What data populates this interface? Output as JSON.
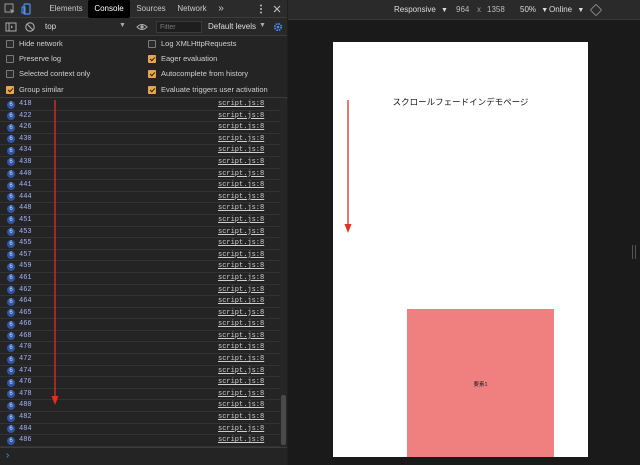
{
  "devtools": {
    "tabs": [
      {
        "label": "Elements"
      },
      {
        "label": "Console"
      },
      {
        "label": "Sources"
      },
      {
        "label": "Network"
      }
    ],
    "more_tabs": "»",
    "context": "top",
    "filter_placeholder": "Filter",
    "levels": "Default levels",
    "settings": {
      "left": [
        {
          "label": "Hide network",
          "checked": false
        },
        {
          "label": "Preserve log",
          "checked": false
        },
        {
          "label": "Selected context only",
          "checked": false
        },
        {
          "label": "Group similar",
          "checked": true
        }
      ],
      "right": [
        {
          "label": "Log XMLHttpRequests",
          "checked": false
        },
        {
          "label": "Eager evaluation",
          "checked": true
        },
        {
          "label": "Autocomplete from history",
          "checked": true
        },
        {
          "label": "Evaluate triggers user activation",
          "checked": true
        }
      ]
    },
    "log_rows": [
      {
        "count": "6",
        "value": "418",
        "source": "script.js:8"
      },
      {
        "count": "6",
        "value": "422",
        "source": "script.js:8"
      },
      {
        "count": "6",
        "value": "426",
        "source": "script.js:8"
      },
      {
        "count": "6",
        "value": "430",
        "source": "script.js:8"
      },
      {
        "count": "6",
        "value": "434",
        "source": "script.js:8"
      },
      {
        "count": "6",
        "value": "438",
        "source": "script.js:8"
      },
      {
        "count": "6",
        "value": "440",
        "source": "script.js:8"
      },
      {
        "count": "6",
        "value": "441",
        "source": "script.js:8"
      },
      {
        "count": "6",
        "value": "444",
        "source": "script.js:8"
      },
      {
        "count": "6",
        "value": "448",
        "source": "script.js:8"
      },
      {
        "count": "6",
        "value": "451",
        "source": "script.js:8"
      },
      {
        "count": "6",
        "value": "453",
        "source": "script.js:8"
      },
      {
        "count": "6",
        "value": "455",
        "source": "script.js:8"
      },
      {
        "count": "6",
        "value": "457",
        "source": "script.js:8"
      },
      {
        "count": "6",
        "value": "459",
        "source": "script.js:8"
      },
      {
        "count": "6",
        "value": "461",
        "source": "script.js:8"
      },
      {
        "count": "6",
        "value": "462",
        "source": "script.js:8"
      },
      {
        "count": "6",
        "value": "464",
        "source": "script.js:8"
      },
      {
        "count": "6",
        "value": "465",
        "source": "script.js:8"
      },
      {
        "count": "6",
        "value": "466",
        "source": "script.js:8"
      },
      {
        "count": "6",
        "value": "468",
        "source": "script.js:8"
      },
      {
        "count": "6",
        "value": "470",
        "source": "script.js:8"
      },
      {
        "count": "6",
        "value": "472",
        "source": "script.js:8"
      },
      {
        "count": "6",
        "value": "474",
        "source": "script.js:8"
      },
      {
        "count": "6",
        "value": "476",
        "source": "script.js:8"
      },
      {
        "count": "6",
        "value": "478",
        "source": "script.js:8"
      },
      {
        "count": "6",
        "value": "480",
        "source": "script.js:8"
      },
      {
        "count": "6",
        "value": "482",
        "source": "script.js:8"
      },
      {
        "count": "6",
        "value": "484",
        "source": "script.js:8"
      },
      {
        "count": "6",
        "value": "486",
        "source": "script.js:8"
      }
    ],
    "prompt_symbol": "›"
  },
  "device_toolbar": {
    "device": "Responsive",
    "width": "964",
    "times": "x",
    "height": "1358",
    "zoom": "50%",
    "network": "Online"
  },
  "page": {
    "heading": "スクロールフェードインデモページ",
    "box_label": "要素1",
    "box_color": "#f08080"
  },
  "colors": {
    "accent": "#e9a64b",
    "active_icon": "#4d90fe",
    "arrow": "#e0301e"
  }
}
